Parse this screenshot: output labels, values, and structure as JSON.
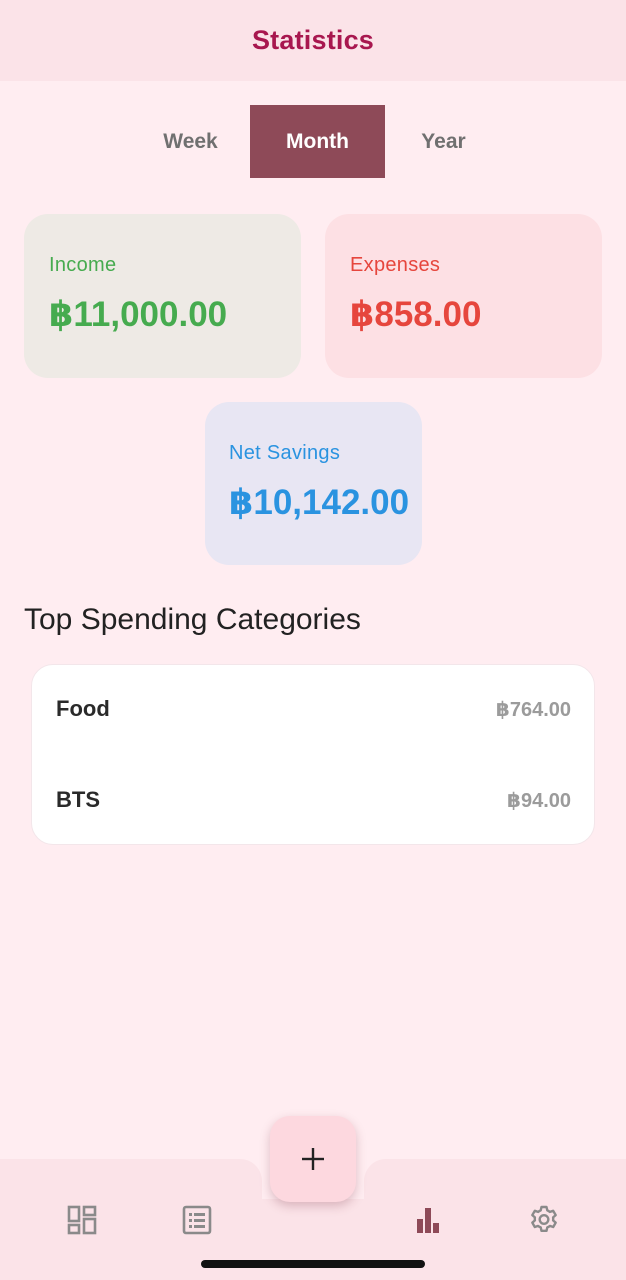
{
  "app_bar": {
    "title": "Statistics"
  },
  "period_toggle": {
    "options": [
      "Week",
      "Month",
      "Year"
    ],
    "selected": "Month"
  },
  "summary": {
    "income": {
      "label": "Income",
      "amount": "฿11,000.00",
      "color": "#46ab4f"
    },
    "expenses": {
      "label": "Expenses",
      "amount": "฿858.00",
      "color": "#e6463d"
    },
    "net_savings": {
      "label": "Net Savings",
      "amount": "฿10,142.00",
      "color": "#2a93e0"
    }
  },
  "top_categories": {
    "title": "Top Spending Categories",
    "items": [
      {
        "name": "Food",
        "amount": "฿764.00"
      },
      {
        "name": "BTS",
        "amount": "฿94.00"
      }
    ]
  },
  "bottom_nav": {
    "items": [
      {
        "icon": "dashboard-icon",
        "active": false
      },
      {
        "icon": "list-icon",
        "active": false
      },
      {
        "icon": "bar-chart-icon",
        "active": true
      },
      {
        "icon": "gear-icon",
        "active": false
      }
    ],
    "fab_icon": "plus-icon"
  },
  "colors": {
    "accent": "#a8174f",
    "selected_toggle": "#8e4a58",
    "background": "#ffedf1"
  }
}
